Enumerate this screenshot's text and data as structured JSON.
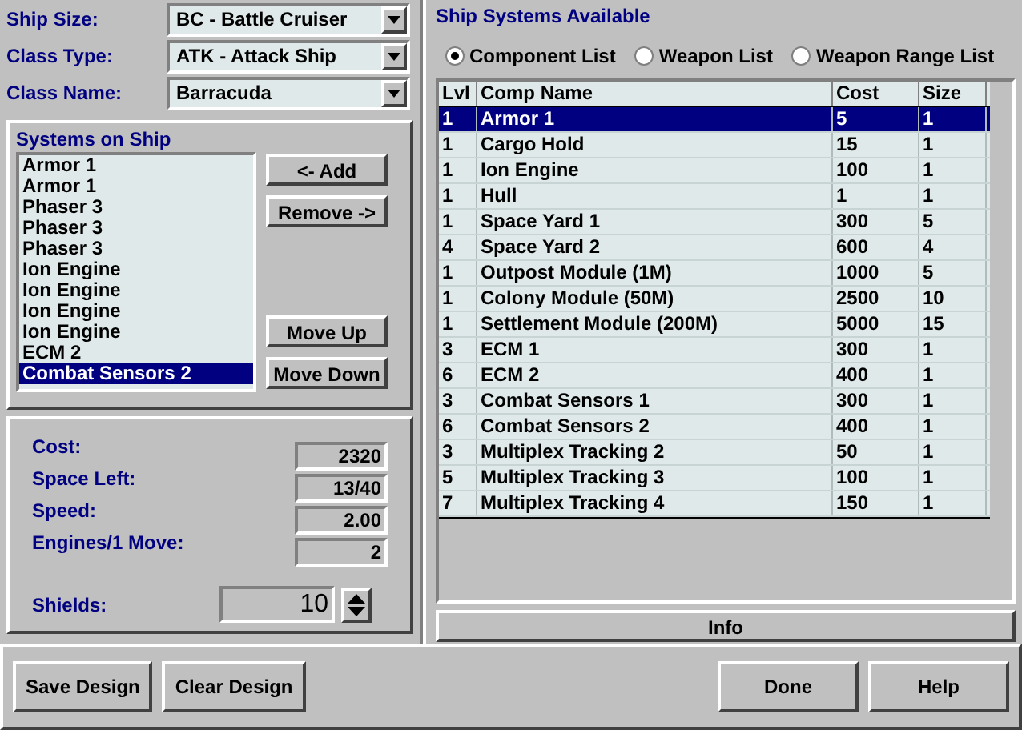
{
  "ship_fields": [
    {
      "label": "Ship Size:",
      "value": "BC - Battle Cruiser"
    },
    {
      "label": "Class Type:",
      "value": "ATK - Attack Ship"
    },
    {
      "label": "Class Name:",
      "value": "Barracuda"
    }
  ],
  "systems_on_ship": {
    "title": "Systems on Ship",
    "items": [
      {
        "label": "Armor 1",
        "selected": false
      },
      {
        "label": "Armor 1",
        "selected": false
      },
      {
        "label": "Phaser 3",
        "selected": false
      },
      {
        "label": "Phaser 3",
        "selected": false
      },
      {
        "label": "Phaser 3",
        "selected": false
      },
      {
        "label": "Ion Engine",
        "selected": false
      },
      {
        "label": "Ion Engine",
        "selected": false
      },
      {
        "label": "Ion Engine",
        "selected": false
      },
      {
        "label": "Ion Engine",
        "selected": false
      },
      {
        "label": "ECM 2",
        "selected": false
      },
      {
        "label": "Combat Sensors 2",
        "selected": true
      }
    ],
    "top_buttons": [
      "<- Add",
      "Remove ->"
    ],
    "bottom_buttons": [
      "Move Up",
      "Move Down"
    ]
  },
  "stats": [
    {
      "label": "Cost:",
      "value": "2320"
    },
    {
      "label": "Space Left:",
      "value": "13/40"
    },
    {
      "label": "Speed:",
      "value": "2.00"
    },
    {
      "label": "Engines/1 Move:",
      "value": "2"
    }
  ],
  "shields": {
    "label": "Shields:",
    "value": "10"
  },
  "available": {
    "title": "Ship Systems Available",
    "view_options": [
      {
        "label": "Component List",
        "selected": true
      },
      {
        "label": "Weapon List",
        "selected": false
      },
      {
        "label": "Weapon Range List",
        "selected": false
      }
    ],
    "columns": [
      "Lvl",
      "Comp Name",
      "Cost",
      "Size"
    ],
    "rows": [
      {
        "cells": [
          "1",
          "Armor 1",
          "5",
          "1"
        ],
        "selected": true
      },
      {
        "cells": [
          "1",
          "Cargo Hold",
          "15",
          "1"
        ],
        "selected": false
      },
      {
        "cells": [
          "1",
          "Ion Engine",
          "100",
          "1"
        ],
        "selected": false
      },
      {
        "cells": [
          "1",
          "Hull",
          "1",
          "1"
        ],
        "selected": false
      },
      {
        "cells": [
          "1",
          "Space Yard 1",
          "300",
          "5"
        ],
        "selected": false
      },
      {
        "cells": [
          "4",
          "Space Yard 2",
          "600",
          "4"
        ],
        "selected": false
      },
      {
        "cells": [
          "1",
          "Outpost Module (1M)",
          "1000",
          "5"
        ],
        "selected": false
      },
      {
        "cells": [
          "1",
          "Colony Module (50M)",
          "2500",
          "10"
        ],
        "selected": false
      },
      {
        "cells": [
          "1",
          "Settlement Module (200M)",
          "5000",
          "15"
        ],
        "selected": false
      },
      {
        "cells": [
          "3",
          "ECM 1",
          "300",
          "1"
        ],
        "selected": false
      },
      {
        "cells": [
          "6",
          "ECM 2",
          "400",
          "1"
        ],
        "selected": false
      },
      {
        "cells": [
          "3",
          "Combat Sensors 1",
          "300",
          "1"
        ],
        "selected": false
      },
      {
        "cells": [
          "6",
          "Combat Sensors 2",
          "400",
          "1"
        ],
        "selected": false
      },
      {
        "cells": [
          "3",
          "Multiplex Tracking 2",
          "50",
          "1"
        ],
        "selected": false
      },
      {
        "cells": [
          "5",
          "Multiplex Tracking 3",
          "100",
          "1"
        ],
        "selected": false
      },
      {
        "cells": [
          "7",
          "Multiplex Tracking 4",
          "150",
          "1"
        ],
        "selected": false
      }
    ],
    "info_button": "Info"
  },
  "footer_left": [
    "Save Design",
    "Clear Design"
  ],
  "footer_right": [
    "Done",
    "Help"
  ]
}
